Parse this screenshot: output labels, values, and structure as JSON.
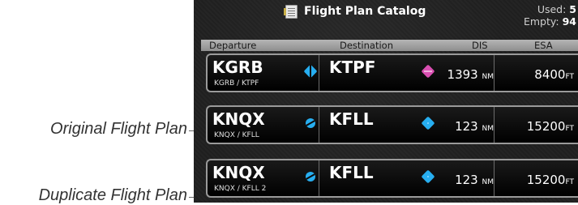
{
  "callouts": {
    "original": "Original Flight Plan",
    "duplicate": "Duplicate Flight Plan"
  },
  "header": {
    "title": "Flight Plan Catalog",
    "used_label": "Used:",
    "used_value": "5",
    "empty_label": "Empty:",
    "empty_value": "94",
    "icon": "catalog-icon"
  },
  "columns": {
    "departure": "Departure",
    "destination": "Destination",
    "dis": "DIS",
    "esa": "ESA"
  },
  "flight_plans": [
    {
      "departure": "KGRB",
      "departure_icon": "airport-diamond-icon",
      "destination": "KTPF",
      "destination_icon": "airport-diamond-magenta-icon",
      "subtitle": "KGRB / KTPF",
      "dis_value": "1393",
      "dis_unit": "NM",
      "esa_value": "8400",
      "esa_unit": "FT"
    },
    {
      "departure": "KNQX",
      "departure_icon": "airport-circle-icon",
      "destination": "KFLL",
      "destination_icon": "airport-diamond-icon",
      "subtitle": "KNQX / KFLL",
      "dis_value": "123",
      "dis_unit": "NM",
      "esa_value": "15200",
      "esa_unit": "FT"
    },
    {
      "departure": "KNQX",
      "departure_icon": "airport-circle-icon",
      "destination": "KFLL",
      "destination_icon": "airport-diamond-icon",
      "subtitle": "KNQX / KFLL 2",
      "dis_value": "123",
      "dis_unit": "NM",
      "esa_value": "15200",
      "esa_unit": "FT"
    }
  ],
  "colors": {
    "airport_cyan": "#27aef0",
    "airport_magenta": "#d94fb1",
    "header_bar": "#a0a0a0"
  }
}
